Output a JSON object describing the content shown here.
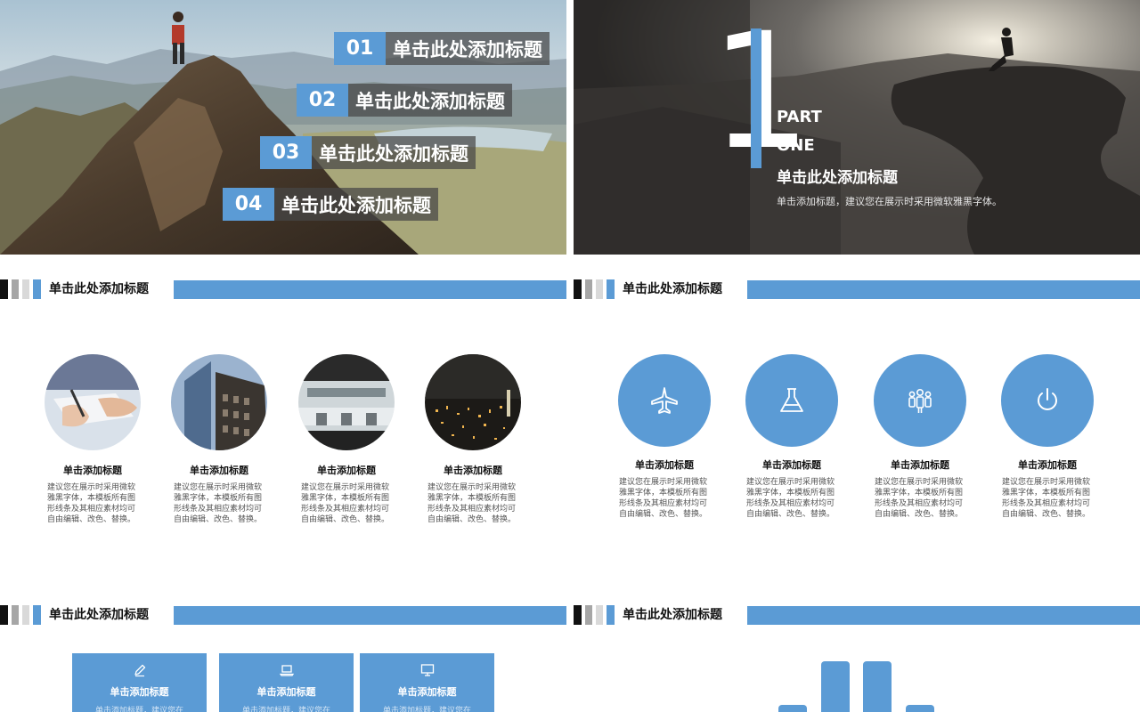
{
  "slide1": {
    "items": [
      {
        "num": "01",
        "label": "单击此处添加标题"
      },
      {
        "num": "02",
        "label": "单击此处添加标题"
      },
      {
        "num": "03",
        "label": "单击此处添加标题"
      },
      {
        "num": "04",
        "label": "单击此处添加标题"
      }
    ]
  },
  "slide2": {
    "digit": "1",
    "part": "PART",
    "one": "ONE",
    "title": "单击此处添加标题",
    "desc": "单击添加标题，建议您在展示时采用微软雅黑字体。"
  },
  "section_title": "单击此处添加标题",
  "slide3": {
    "columns": [
      {
        "title": "单击添加标题",
        "desc": "建议您在展示时采用微软雅黑字体，本模板所有图形线条及其相应素材均可自由编辑、改色、替换。",
        "photo": "handwriting-photo"
      },
      {
        "title": "单击添加标题",
        "desc": "建议您在展示时采用微软雅黑字体，本模板所有图形线条及其相应素材均可自由编辑、改色、替换。",
        "photo": "buildings-photo"
      },
      {
        "title": "单击添加标题",
        "desc": "建议您在展示时采用微软雅黑字体，本模板所有图形线条及其相应素材均可自由编辑、改色、替换。",
        "photo": "interior-photo"
      },
      {
        "title": "单击添加标题",
        "desc": "建议您在展示时采用微软雅黑字体，本模板所有图形线条及其相应素材均可自由编辑、改色、替换。",
        "photo": "city-night-photo"
      }
    ]
  },
  "slide4": {
    "columns": [
      {
        "title": "单击添加标题",
        "desc": "建议您在展示时采用微软雅黑字体，本模板所有图形线条及其相应素材均可自由编辑、改色、替换。",
        "icon": "airplane-icon"
      },
      {
        "title": "单击添加标题",
        "desc": "建议您在展示时采用微软雅黑字体，本模板所有图形线条及其相应素材均可自由编辑、改色、替换。",
        "icon": "flask-icon"
      },
      {
        "title": "单击添加标题",
        "desc": "建议您在展示时采用微软雅黑字体，本模板所有图形线条及其相应素材均可自由编辑、改色、替换。",
        "icon": "team-icon"
      },
      {
        "title": "单击添加标题",
        "desc": "建议您在展示时采用微软雅黑字体，本模板所有图形线条及其相应素材均可自由编辑、改色、替换。",
        "icon": "power-icon"
      }
    ]
  },
  "slide5": {
    "cards": [
      {
        "title": "单击添加标题",
        "desc": "单击添加标题，建议您在",
        "icon": "pencil-icon"
      },
      {
        "title": "单击添加标题",
        "desc": "单击添加标题，建议您在",
        "icon": "laptop-icon"
      },
      {
        "title": "单击添加标题",
        "desc": "单击添加标题，建议您在",
        "icon": "monitor-icon"
      }
    ]
  },
  "colors": {
    "accent": "#5b9bd5",
    "dark": "#111111"
  }
}
